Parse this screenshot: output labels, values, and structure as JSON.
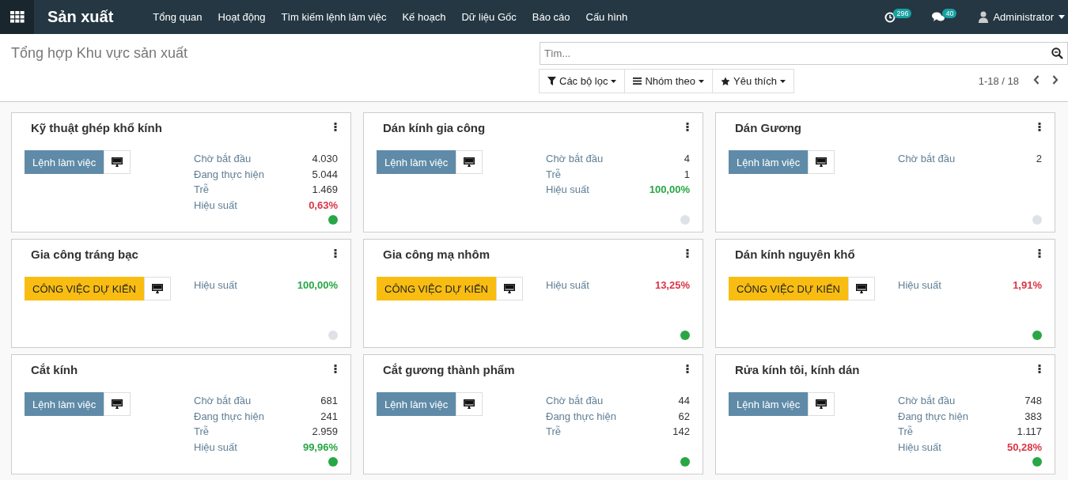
{
  "navbar": {
    "app_name": "Sản xuất",
    "menu": [
      "Tổng quan",
      "Hoạt động",
      "Tìm kiếm lệnh làm việc",
      "Kế hoạch",
      "Dữ liệu Gốc",
      "Báo cáo",
      "Cấu hình"
    ],
    "activity_count": "296",
    "message_count": "40",
    "user": "Administrator"
  },
  "control_panel": {
    "title": "Tổng hợp Khu vực sản xuất",
    "search": {
      "placeholder": "Tìm..."
    },
    "filters": [
      "Các bộ lọc",
      "Nhóm theo",
      "Yêu thích"
    ],
    "pager": "1-18 / 18"
  },
  "cards": [
    {
      "title": "Kỹ thuật ghép khổ kính",
      "button": {
        "label": "Lệnh làm việc",
        "kind": "orders"
      },
      "stats": [
        {
          "label": "Chờ bắt đầu",
          "value": "4.030"
        },
        {
          "label": "Đang thực hiện",
          "value": "5.044"
        },
        {
          "label": "Trễ",
          "value": "1.469"
        },
        {
          "label": "Hiệu suất",
          "value": "0,63%",
          "color": "#dc3545"
        }
      ],
      "color": "#28a745"
    },
    {
      "title": "Dán kính gia công",
      "button": {
        "label": "Lệnh làm việc",
        "kind": "orders"
      },
      "stats": [
        {
          "label": "Chờ bắt đầu",
          "value": "4"
        },
        {
          "label": "Trễ",
          "value": "1"
        },
        {
          "label": "Hiệu suất",
          "value": "100,00%",
          "color": "#28a745"
        }
      ],
      "color": "#dee2e6"
    },
    {
      "title": "Dán Gương",
      "button": {
        "label": "Lệnh làm việc",
        "kind": "orders"
      },
      "stats": [
        {
          "label": "Chờ bắt đầu",
          "value": "2"
        }
      ],
      "color": "#dee2e6"
    },
    {
      "title": "Gia công tráng bạc",
      "button": {
        "label": "CÔNG VIỆC DỰ KIẾN",
        "kind": "planned"
      },
      "stats": [
        {
          "label": "Hiệu suất",
          "value": "100,00%",
          "color": "#28a745"
        }
      ],
      "color": "#dee2e6"
    },
    {
      "title": "Gia công mạ nhôm",
      "button": {
        "label": "CÔNG VIỆC DỰ KIẾN",
        "kind": "planned"
      },
      "stats": [
        {
          "label": "Hiệu suất",
          "value": "13,25%",
          "color": "#dc3545"
        }
      ],
      "color": "#28a745"
    },
    {
      "title": "Dán kính nguyên khổ",
      "button": {
        "label": "CÔNG VIỆC DỰ KIẾN",
        "kind": "planned"
      },
      "stats": [
        {
          "label": "Hiệu suất",
          "value": "1,91%",
          "color": "#dc3545"
        }
      ],
      "color": "#28a745"
    },
    {
      "title": "Cắt kính",
      "button": {
        "label": "Lệnh làm việc",
        "kind": "orders"
      },
      "stats": [
        {
          "label": "Chờ bắt đầu",
          "value": "681"
        },
        {
          "label": "Đang thực hiện",
          "value": "241"
        },
        {
          "label": "Trễ",
          "value": "2.959"
        },
        {
          "label": "Hiệu suất",
          "value": "99,96%",
          "color": "#28a745"
        }
      ],
      "color": "#28a745"
    },
    {
      "title": "Cắt gương thành phẩm",
      "button": {
        "label": "Lệnh làm việc",
        "kind": "orders"
      },
      "stats": [
        {
          "label": "Chờ bắt đầu",
          "value": "44"
        },
        {
          "label": "Đang thực hiện",
          "value": "62"
        },
        {
          "label": "Trễ",
          "value": "142"
        }
      ],
      "color": "#28a745"
    },
    {
      "title": "Rửa kính tôi, kính dán",
      "button": {
        "label": "Lệnh làm việc",
        "kind": "orders"
      },
      "stats": [
        {
          "label": "Chờ bắt đầu",
          "value": "748"
        },
        {
          "label": "Đang thực hiện",
          "value": "383"
        },
        {
          "label": "Trễ",
          "value": "1.117"
        },
        {
          "label": "Hiệu suất",
          "value": "50,28%",
          "color": "#dc3545"
        }
      ],
      "color": "#28a745"
    }
  ]
}
